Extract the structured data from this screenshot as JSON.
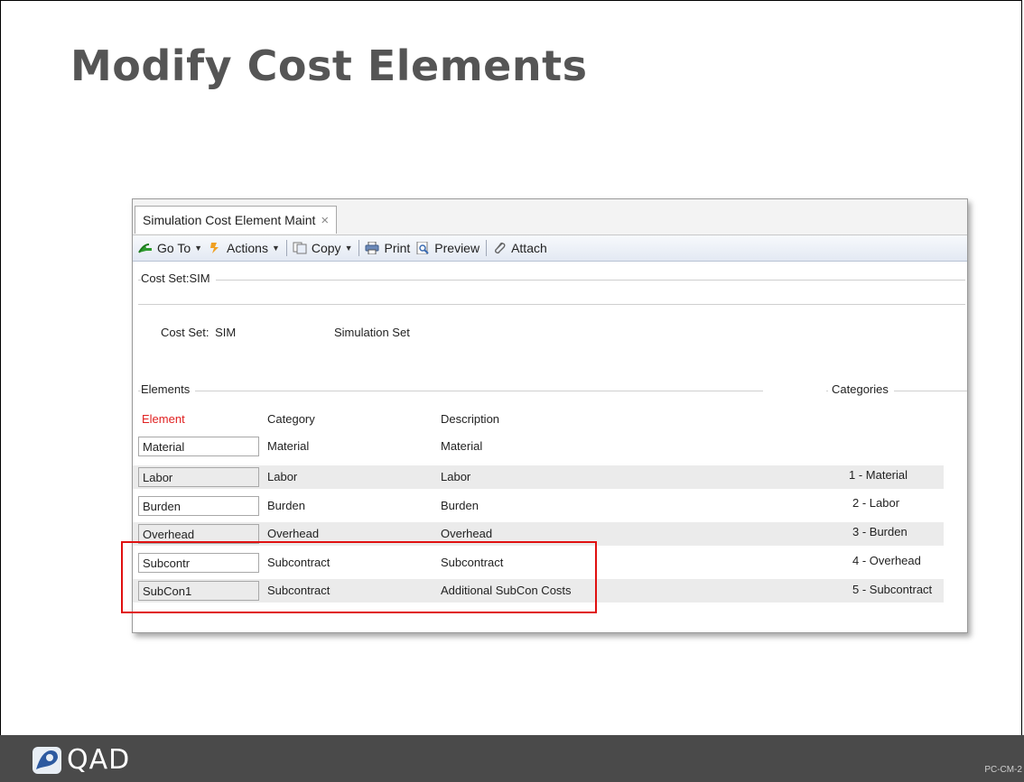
{
  "slide": {
    "title": "Modify Cost Elements",
    "code": "PC-CM-2"
  },
  "window": {
    "tab_label": "Simulation Cost Element Maint",
    "close_glyph": "×"
  },
  "toolbar": {
    "goto": "Go To",
    "actions": "Actions",
    "copy": "Copy",
    "print": "Print",
    "preview": "Preview",
    "attach": "Attach"
  },
  "form": {
    "cost_set_group": "Cost Set:SIM",
    "cost_set_label": "Cost Set:",
    "cost_set_value": "SIM",
    "cost_set_desc": "Simulation Set",
    "elements_group": "Elements",
    "categories_group": "Categories"
  },
  "table": {
    "headers": {
      "element": "Element",
      "category": "Category",
      "description": "Description"
    },
    "rows": [
      {
        "element": "Material",
        "category": "Material",
        "description": "Material"
      },
      {
        "element": "Labor",
        "category": "Labor",
        "description": "Labor"
      },
      {
        "element": "Burden",
        "category": "Burden",
        "description": "Burden"
      },
      {
        "element": "Overhead",
        "category": "Overhead",
        "description": "Overhead"
      },
      {
        "element": "Subcontr",
        "category": "Subcontract",
        "description": "Subcontract"
      },
      {
        "element": "SubCon1",
        "category": "Subcontract",
        "description": "Additional SubCon Costs"
      }
    ]
  },
  "categories": [
    "1 - Material",
    "2 - Labor",
    "3 - Burden",
    "4 - Overhead",
    "5 - Subcontract"
  ],
  "footer": {
    "logo_text": "QAD"
  },
  "colors": {
    "highlight": "#e01010",
    "required_label": "#e02020",
    "footer_bg": "#4a4a4a"
  },
  "icons": [
    "goto-arrow-icon",
    "actions-icon",
    "copy-icon",
    "print-icon",
    "preview-icon",
    "attach-paperclip-icon",
    "qad-logo-icon"
  ]
}
